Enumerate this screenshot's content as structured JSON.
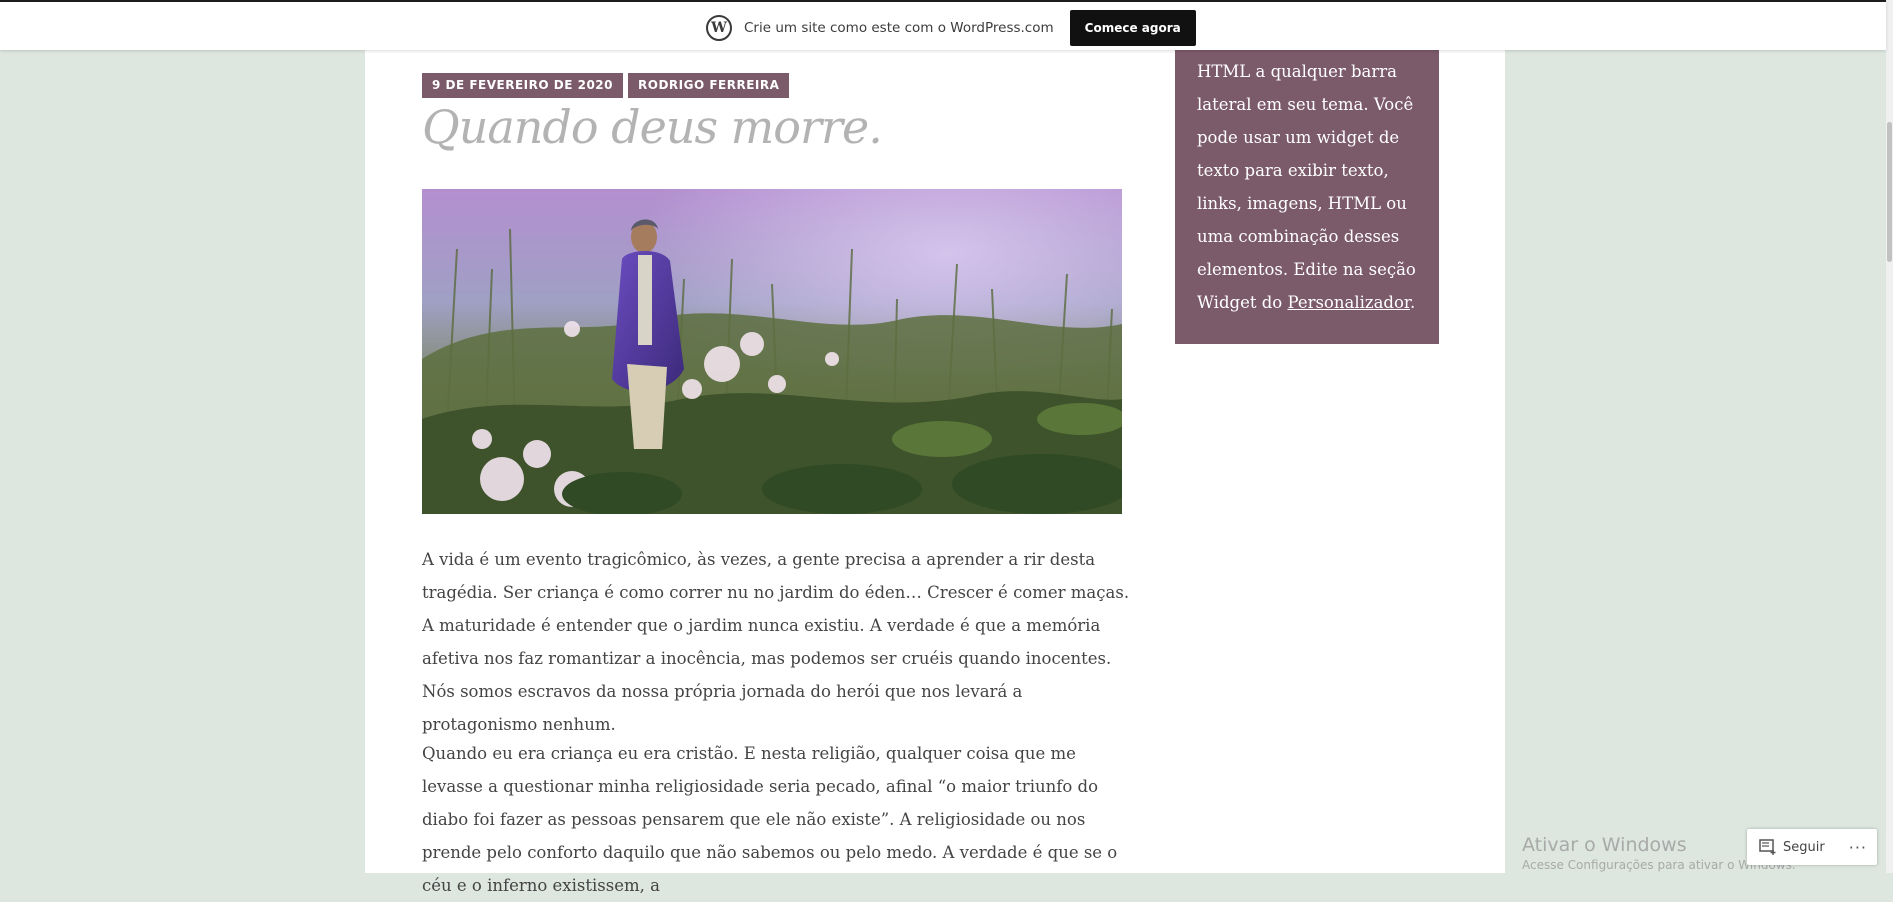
{
  "topbar": {
    "logo_icon": "wordpress-logo-icon",
    "text": "Crie um site como este com o WordPress.com",
    "cta_label": "Comece agora"
  },
  "post": {
    "date": "9 DE FEVEREIRO DE 2020",
    "author": "RODRIGO FERREIRA",
    "title": "Quando deus morre.",
    "paragraph1": "A vida é um evento tragicômico, às vezes, a gente precisa a aprender a rir desta tragédia. Ser criança é como correr nu no jardim do éden… Crescer é comer maças. A maturidade é entender que o jardim nunca existiu. A verdade é que a memória afetiva nos faz romantizar a inocência, mas podemos ser cruéis quando inocentes. Nós somos escravos da nossa própria jornada do herói que nos levará a protagonismo nenhum.",
    "paragraph2": "Quando eu era criança eu era cristão. E nesta religião, qualquer coisa que me levasse a questionar minha religiosidade seria pecado, afinal “o maior triunfo do diabo foi fazer as pessoas pensarem que ele não existe”. A religiosidade ou nos prende pelo conforto daquilo que não sabemos ou pelo medo. A verdade é que se o céu e o inferno existissem, a"
  },
  "sidebar": {
    "widget_text": "HTML a qualquer barra lateral em seu tema. Você pode usar um widget de texto para exibir texto, links, imagens, HTML ou uma combinação desses elementos. Edite na seção Widget do ",
    "widget_link": "Personalizador",
    "widget_end": "."
  },
  "windows_watermark": {
    "title": "Ativar o Windows",
    "subtitle": "Acesse Configurações para ativar o Windows."
  },
  "follow_bar": {
    "follow_label": "Seguir",
    "more_label": "···"
  },
  "colors": {
    "accent": "#7b5a69",
    "background": "#dde6df",
    "title": "#b3b3b3"
  }
}
